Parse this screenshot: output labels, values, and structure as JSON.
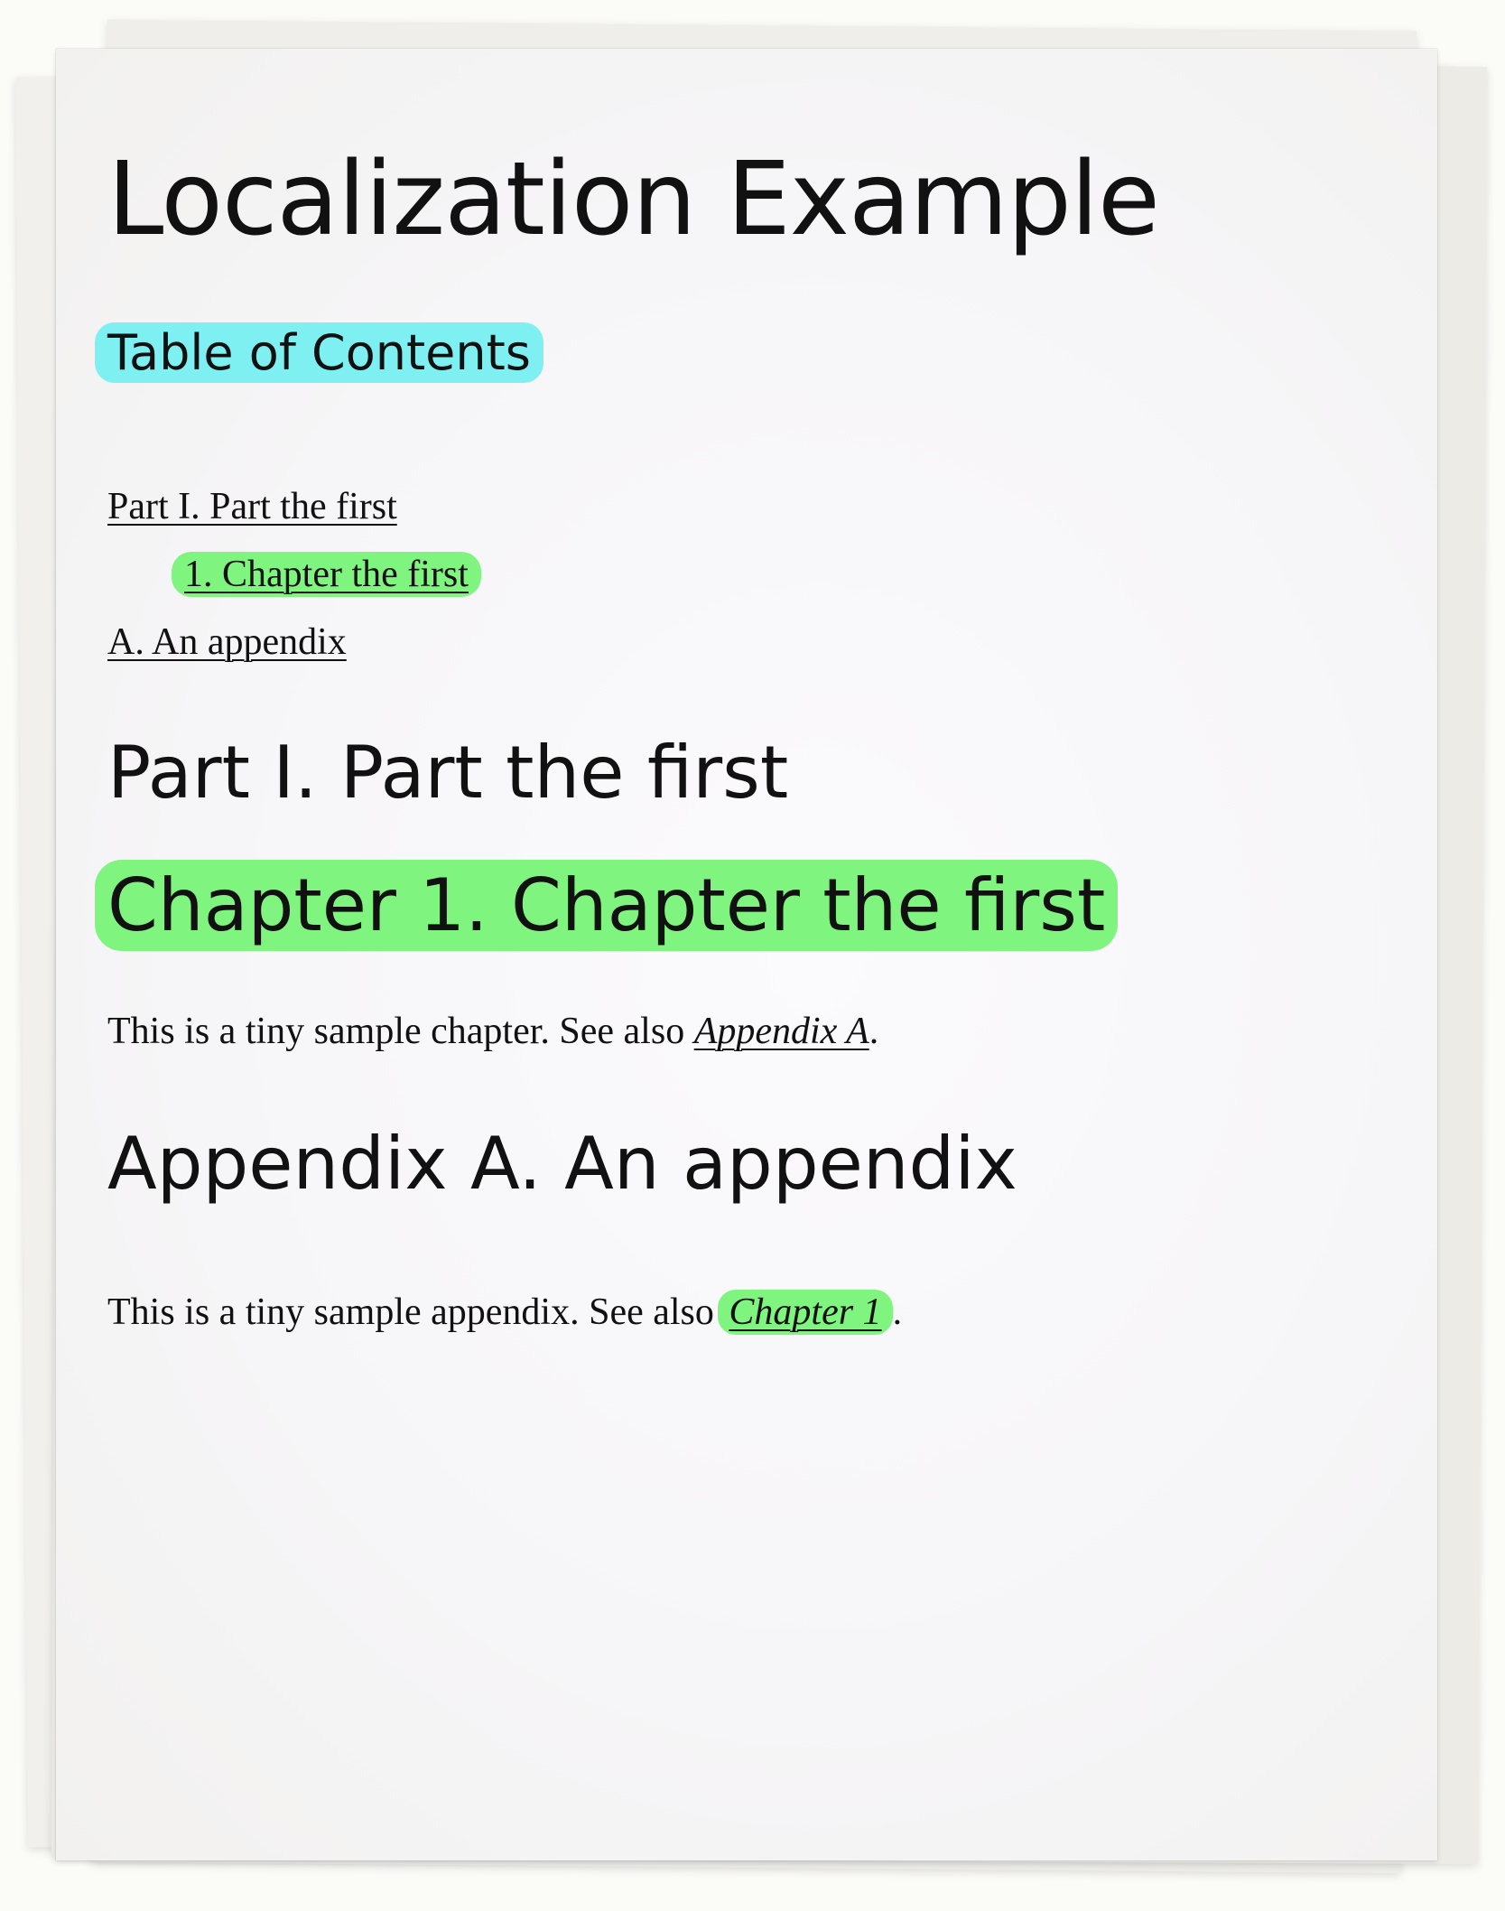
{
  "document": {
    "title": "Localization Example",
    "toc": {
      "heading": "Table of Contents",
      "items": [
        {
          "label": "Part I. Part the first"
        },
        {
          "label": "1. Chapter the first"
        },
        {
          "label": "A. An appendix"
        }
      ]
    },
    "part_heading": "Part I. Part the first",
    "chapter_heading": "Chapter 1. Chapter the first",
    "chapter_para": {
      "text": "This is a tiny sample chapter. See also ",
      "link": "Appendix A",
      "end": "."
    },
    "appendix_heading": "Appendix A. An appendix",
    "appendix_para": {
      "text": "This is a tiny sample appendix. See also ",
      "link": "Chapter 1",
      "end": "."
    }
  },
  "colors": {
    "highlight_cyan": "#7ff0f2",
    "highlight_green": "#7ff57f",
    "text": "#111111"
  }
}
